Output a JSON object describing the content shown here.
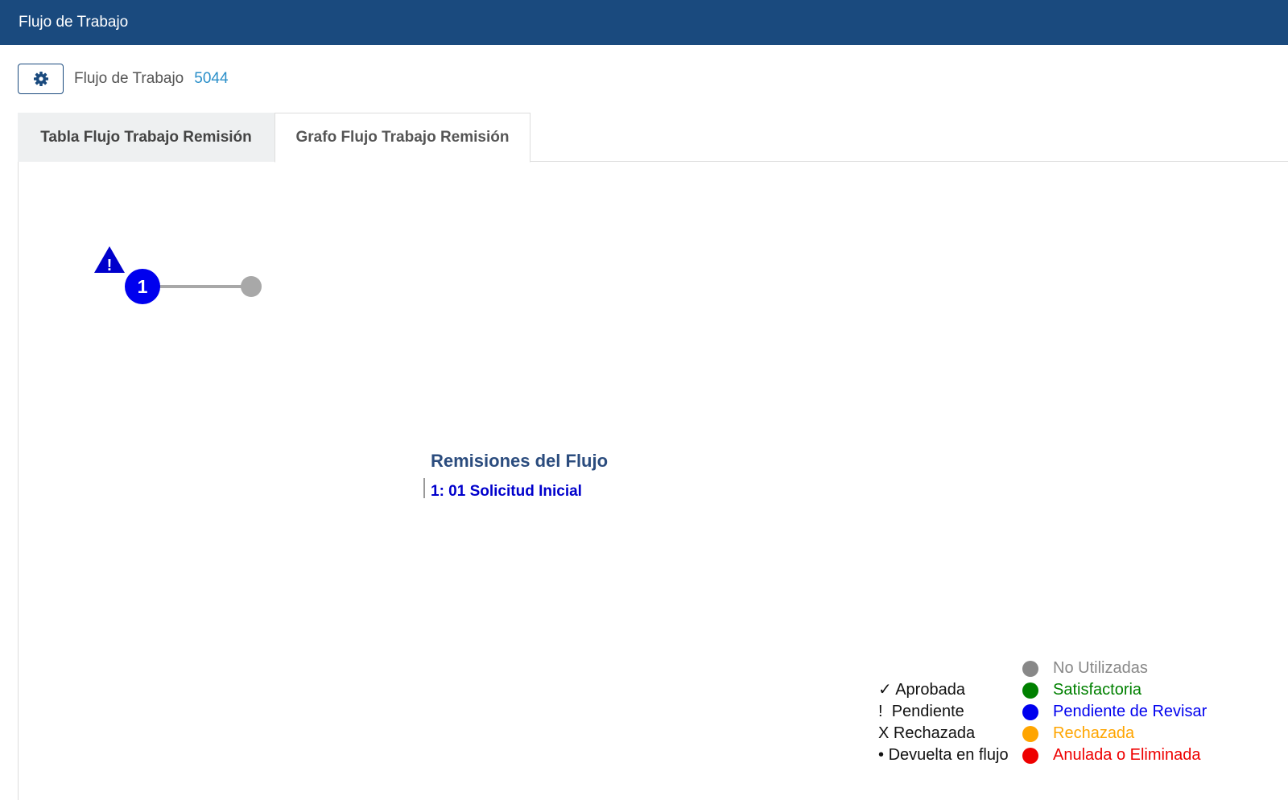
{
  "header": {
    "title": "Flujo de Trabajo"
  },
  "subheader": {
    "label": "Flujo de Trabajo",
    "id": "5044"
  },
  "tabs": [
    {
      "label": "Tabla Flujo Trabajo Remisión",
      "active": false
    },
    {
      "label": "Grafo Flujo Trabajo Remisión",
      "active": true
    }
  ],
  "graph": {
    "node_label": "1",
    "node_status": "pending",
    "node_color": "#0000ee",
    "end_node_color": "#a8a8a8",
    "warning_color": "#0000cc"
  },
  "remisiones": {
    "title": "Remisiones del Flujo",
    "items": [
      "1: 01 Solicitud Inicial"
    ]
  },
  "legend": {
    "symbols": [
      {
        "symbol": "✓",
        "label": "Aprobada"
      },
      {
        "symbol": "!",
        "label": "Pendiente"
      },
      {
        "symbol": "X",
        "label": "Rechazada"
      },
      {
        "symbol": "•",
        "label": "Devuelta en flujo"
      }
    ],
    "colors": [
      {
        "label": "No Utilizadas",
        "color": "#888888"
      },
      {
        "label": "Satisfactoria",
        "color": "#008000"
      },
      {
        "label": "Pendiente de Revisar",
        "color": "#0000ee"
      },
      {
        "label": "Rechazada",
        "color": "#ffa500"
      },
      {
        "label": "Anulada o Eliminada",
        "color": "#ee0000"
      }
    ]
  }
}
